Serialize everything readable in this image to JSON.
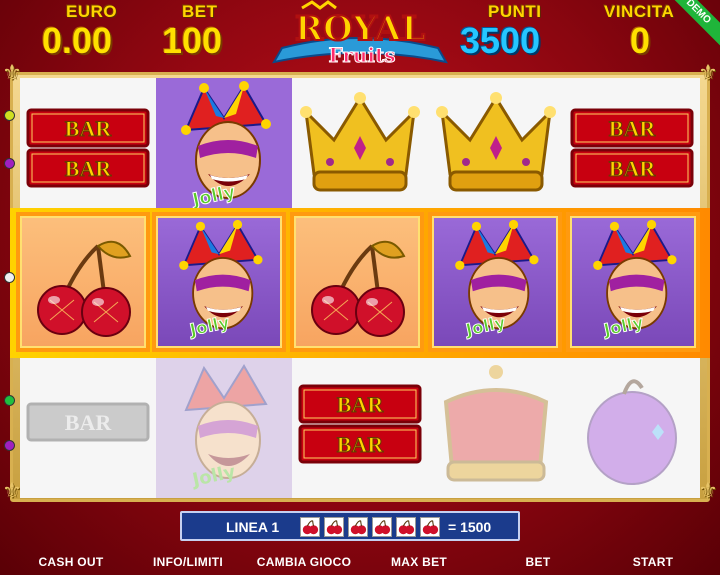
{
  "header": {
    "euro_label": "EURO",
    "euro_value": "0.00",
    "bet_label": "BET",
    "bet_value": "100",
    "points_label": "PUNTI",
    "points_value": "3500",
    "win_label": "VINCITA",
    "win_value": "0",
    "logo_word1": "ROYAL",
    "logo_word2": "Fruits",
    "demo_badge": "DEMO"
  },
  "reels": {
    "row1": [
      "bar",
      "jolly",
      "crown",
      "crown",
      "bar"
    ],
    "row2": [
      "cherry",
      "jolly",
      "cherry",
      "jolly",
      "jolly"
    ],
    "row3": [
      "bar",
      "jolly",
      "bar",
      "crown",
      "plum"
    ],
    "bar_text": "BAR",
    "jolly_text": "Jolly"
  },
  "winline": {
    "label": "LINEA 1",
    "symbol": "cherry",
    "count": 6,
    "payout": "= 1500"
  },
  "buttons": {
    "cash_out": "CASH OUT",
    "info": "INFO/LIMITI",
    "change_game": "CAMBIA GIOCO",
    "max_bet": "MAX BET",
    "bet": "BET",
    "start": "START"
  },
  "colors": {
    "background": "#b00814",
    "gold": "#ffd400",
    "points_blue": "#25c6ff",
    "panel_blue": "#1b3b8c",
    "demo_green": "#1fb53a"
  }
}
